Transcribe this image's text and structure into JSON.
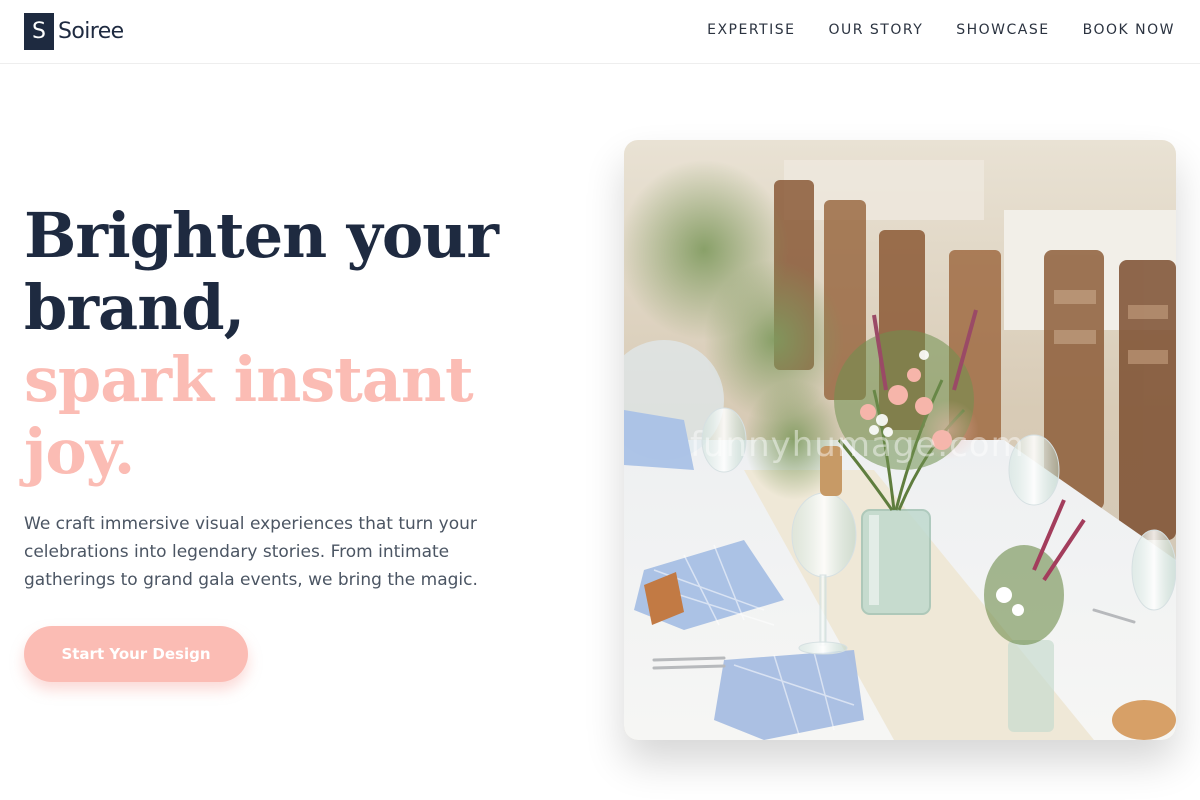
{
  "brand": {
    "mark": "S",
    "name": "Soiree",
    "color": "#1e2a40"
  },
  "nav": {
    "items": [
      {
        "label": "EXPERTISE"
      },
      {
        "label": "OUR STORY"
      },
      {
        "label": "SHOWCASE"
      },
      {
        "label": "BOOK NOW"
      }
    ]
  },
  "hero": {
    "headline_line1": "Brighten your",
    "headline_line2": "brand,",
    "headline_line3": "spark instant",
    "headline_line4": "joy.",
    "description": "We craft immersive visual experiences that turn your celebrations into legendary stories. From intimate gatherings to grand gala events, we bring the magic.",
    "cta_label": "Start Your Design",
    "accent_color": "#fbbcb4",
    "photo_watermark": "funnyhumage.com"
  }
}
